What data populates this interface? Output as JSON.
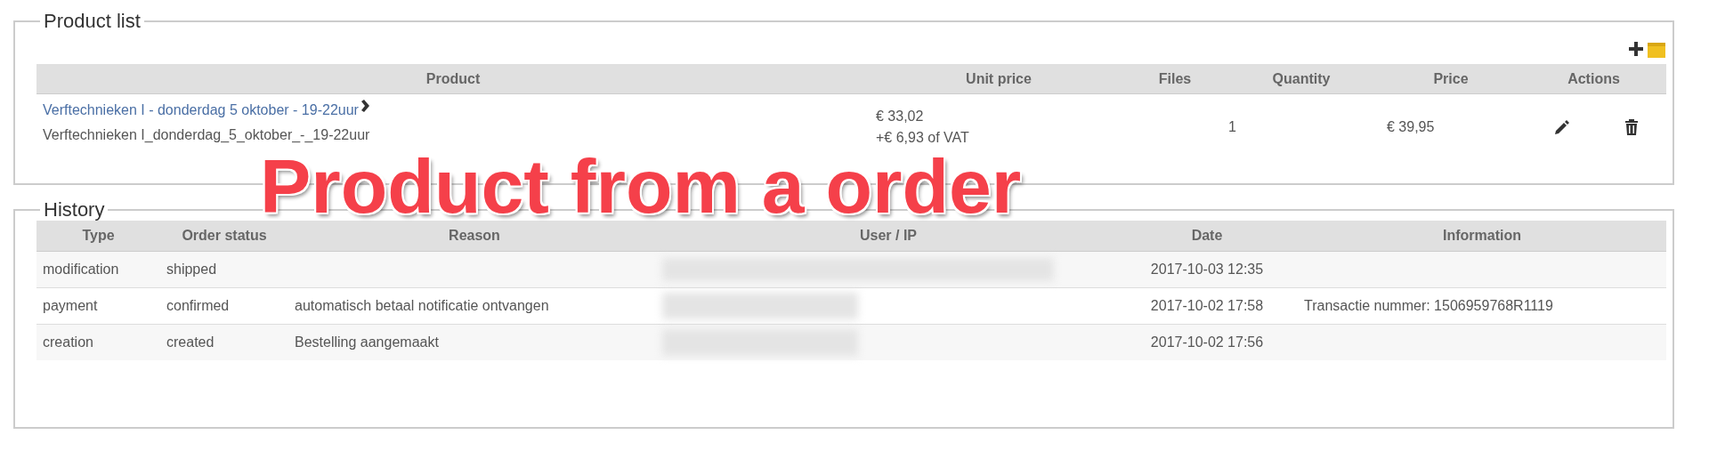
{
  "product_list": {
    "title": "Product list",
    "columns": [
      "Product",
      "Unit price",
      "Files",
      "Quantity",
      "Price",
      "Actions"
    ],
    "rows": [
      {
        "product_link": "Verftechnieken I - donderdag 5 oktober - 19-22uur",
        "product_code": "Verftechnieken I_donderdag_5_oktober_-_19-22uur",
        "unit_price": "€ 33,02",
        "vat": "+€ 6,93 of VAT",
        "quantity": "1",
        "price": "€ 39,95"
      }
    ]
  },
  "history": {
    "title": "History",
    "columns": [
      "Type",
      "Order status",
      "Reason",
      "User / IP",
      "Date",
      "Information"
    ],
    "rows": [
      {
        "type": "modification",
        "order_status": "shipped",
        "date": "2017-10-03 12:35"
      },
      {
        "type": "payment",
        "order_status": "confirmed",
        "reason": "automatisch betaal notificatie ontvangen",
        "date": "2017-10-02 17:58",
        "information": "Transactie nummer: 1506959768R1119"
      },
      {
        "type": "creation",
        "order_status": "created",
        "reason": "Bestelling aangemaakt",
        "date": "2017-10-02 17:56"
      }
    ]
  },
  "annotation": "Product from a order"
}
